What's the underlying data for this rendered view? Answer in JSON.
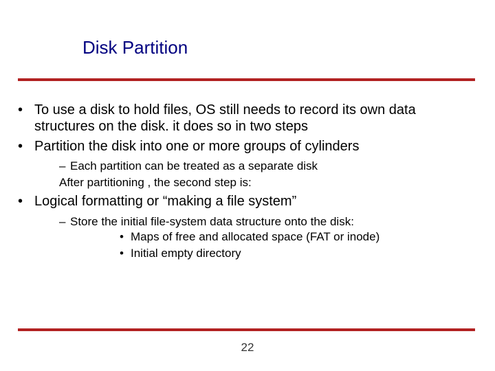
{
  "title": "Disk Partition",
  "bullets": {
    "b1": "To use a disk to hold files, OS still needs to record its own data structures on the disk. it does so in two steps",
    "b2": "Partition the disk into one or more groups of cylinders",
    "b2_sub1": "Each partition can be treated as a separate disk",
    "b2_sub2": "After partitioning , the second step is:",
    "b3": "Logical formatting or “making a file system”",
    "b3_sub1": "Store the initial file-system data structure onto the disk:",
    "b3_sub1_a": "Maps of free and allocated space (FAT or inode)",
    "b3_sub1_b": "Initial empty directory"
  },
  "page_number": "22",
  "colors": {
    "title": "#000080",
    "rule": "#b22222"
  }
}
